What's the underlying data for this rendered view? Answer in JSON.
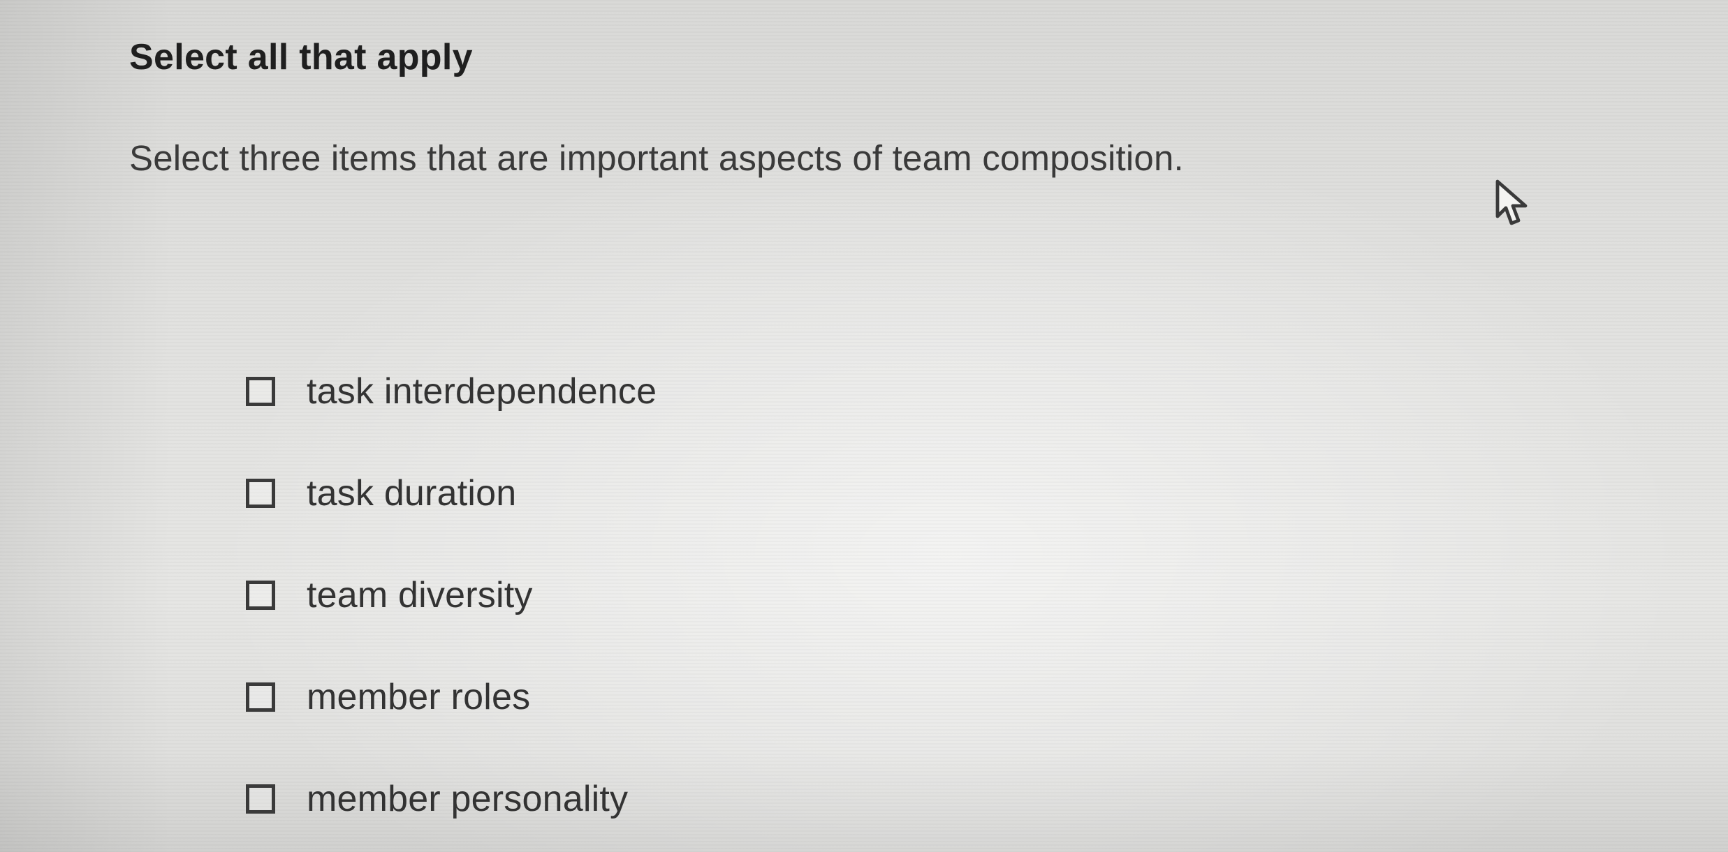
{
  "question": {
    "type_label": "Select all that apply",
    "prompt": "Select three items that are important aspects of team composition."
  },
  "options": [
    {
      "label": "task interdependence",
      "checked": false
    },
    {
      "label": "task duration",
      "checked": false
    },
    {
      "label": "team diversity",
      "checked": false
    },
    {
      "label": "member roles",
      "checked": false
    },
    {
      "label": "member personality",
      "checked": false
    }
  ],
  "cursor": {
    "icon": "arrow-pointer-icon"
  }
}
